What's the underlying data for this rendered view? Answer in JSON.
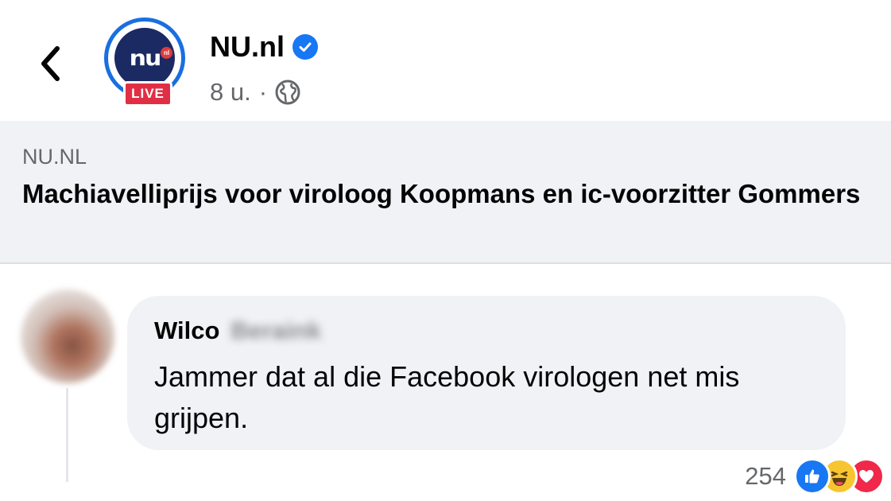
{
  "post": {
    "page_name": "NU.nl",
    "logo_text": "nu",
    "logo_suffix": "nl",
    "live_badge": "LIVE",
    "time": "8 u.",
    "separator": "·"
  },
  "link_preview": {
    "domain": "NU.NL",
    "title": "Machiavelliprijs voor viroloog Koopmans en ic-voorzitter Gommers"
  },
  "comment": {
    "author_first_name": "Wilco",
    "author_last_name_blurred": "Beraink",
    "text": "Jammer dat al die Facebook virologen net mis grijpen."
  },
  "reactions": {
    "count": "254",
    "types": [
      "like",
      "haha",
      "love"
    ]
  },
  "icons": [
    "back-chevron-icon",
    "verified-badge-icon",
    "globe-icon",
    "like-reaction-icon",
    "haha-reaction-icon",
    "love-reaction-icon"
  ],
  "colors": {
    "verified_blue": "#1877f2",
    "live_red": "#e02f45",
    "preview_bg": "#f0f2f5",
    "nu_navy": "#1b2a63"
  }
}
